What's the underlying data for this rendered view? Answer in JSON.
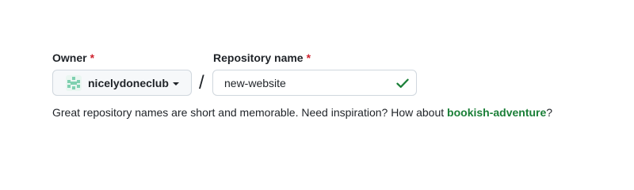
{
  "owner": {
    "label": "Owner",
    "required_mark": "*",
    "selected": "nicelydoneclub",
    "avatar_icon": "identicon-icon"
  },
  "separator": "/",
  "repository": {
    "label": "Repository name",
    "required_mark": "*",
    "value": "new-website",
    "valid_icon": "check-icon"
  },
  "hint": {
    "text": "Great repository names are short and memorable. Need inspiration? How about ",
    "suggestion": "bookish-adventure",
    "end": "?"
  },
  "colors": {
    "required": "#cf222e",
    "valid": "#1a7f37",
    "suggestion": "#1a7f37",
    "avatar": "#7fd0b0"
  }
}
